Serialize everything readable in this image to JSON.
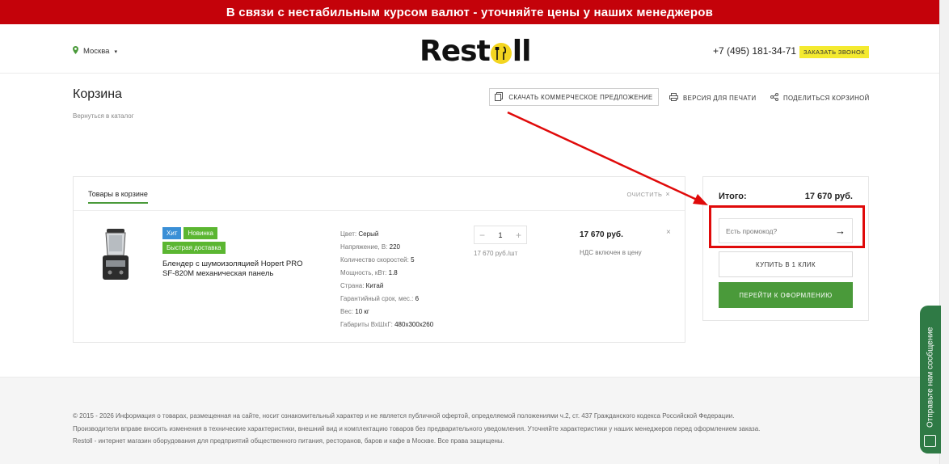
{
  "banner": {
    "text": "В связи с нестабильным курсом валют - уточняйте цены у наших менеджеров"
  },
  "header": {
    "city": "Москва",
    "logo_part1": "Rest",
    "logo_part2": "ll",
    "phone": "+7 (495) 181-34-71",
    "callback_label": "ЗАКАЗАТЬ ЗВОНОК"
  },
  "page": {
    "title": "Корзина",
    "back_link": "Вернуться в каталог",
    "download_offer": "СКАЧАТЬ КОММЕРЧЕСКОЕ ПРЕДЛОЖЕНИЕ",
    "print_version": "ВЕРСИЯ ДЛЯ ПЕЧАТИ",
    "share_cart": "ПОДЕЛИТЬСЯ КОРЗИНОЙ"
  },
  "cart": {
    "tab_label": "Товары в корзине",
    "clear_label": "ОЧИСТИТЬ",
    "item": {
      "badges": {
        "hit": "Хит",
        "new": "Новинка",
        "fast": "Быстрая доставка"
      },
      "name": "Блендер с шумоизоляцией Hopert PRO SF-820M механическая панель",
      "specs": [
        {
          "label": "Цвет:",
          "value": "Серый"
        },
        {
          "label": "Напряжение, В:",
          "value": "220"
        },
        {
          "label": "Количество скоростей:",
          "value": "5"
        },
        {
          "label": "Мощность, кВт:",
          "value": "1.8"
        },
        {
          "label": "Страна:",
          "value": "Китай"
        },
        {
          "label": "Гарантийный срок, мес.:",
          "value": "6"
        },
        {
          "label": "Вес:",
          "value": "10 кг"
        },
        {
          "label": "Габариты ВхШхГ:",
          "value": "480х300х260"
        }
      ],
      "quantity": "1",
      "minus": "−",
      "plus": "+",
      "unit_price": "17 670 руб./шт",
      "total": "17 670 руб.",
      "vat_note": "НДС включен в цену",
      "remove": "×"
    }
  },
  "summary": {
    "total_label": "Итого:",
    "total_value": "17 670 руб.",
    "promo_placeholder": "Есть промокод?",
    "promo_arrow": "→",
    "one_click": "КУПИТЬ В 1 КЛИК",
    "checkout": "ПЕРЕЙТИ К ОФОРМЛЕНИЮ"
  },
  "footer": {
    "line1": "© 2015 - 2026 Информация о товарах, размещенная на сайте, носит ознакомительный характер и не является публичной офертой, определяемой положениями ч.2, ст. 437 Гражданского кодекса Российской Федерации.",
    "line2": "Производители вправе вносить изменения в технические характеристики, внешний вид и комплектацию товаров без предварительного уведомления. Уточняйте характеристики у наших менеджеров перед оформлением заказа.",
    "line3": "Restoll - интернет магазин оборудования для предприятий общественного питания, ресторанов, баров и кафе в Москве. Все права защищены."
  },
  "chat": {
    "label": "Отправьте нам сообщение"
  },
  "colors": {
    "banner": "#c4020a",
    "accent_green": "#4a9a3a",
    "callback_yellow": "#f4ea2f",
    "annotation_red": "#e00a0a"
  }
}
